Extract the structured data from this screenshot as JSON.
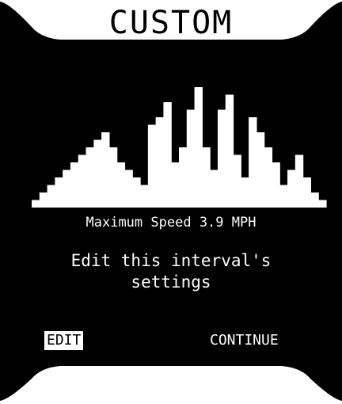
{
  "header": {
    "title": "CUSTOM"
  },
  "interval_profile": {
    "fill_color": "#ffffff",
    "levels": [
      1,
      2,
      3,
      4,
      5,
      6,
      7,
      8,
      9,
      10,
      8,
      6,
      5,
      4,
      3,
      11,
      12,
      14,
      6,
      8,
      13,
      16,
      8,
      5,
      13,
      15,
      7,
      4,
      12,
      10,
      8,
      6,
      3,
      5,
      7,
      4,
      2,
      1
    ]
  },
  "interval_info": {
    "speed_label": "Maximum Speed",
    "speed_value": "3.9",
    "speed_unit": "MPH"
  },
  "prompt": {
    "line1": "Edit this interval's",
    "line2": "settings"
  },
  "actions": {
    "edit_label": "EDIT",
    "continue_label": "CONTINUE"
  },
  "colors": {
    "background": "#000000",
    "foreground": "#ffffff",
    "selected_background": "#ffffff",
    "selected_text": "#000000"
  }
}
